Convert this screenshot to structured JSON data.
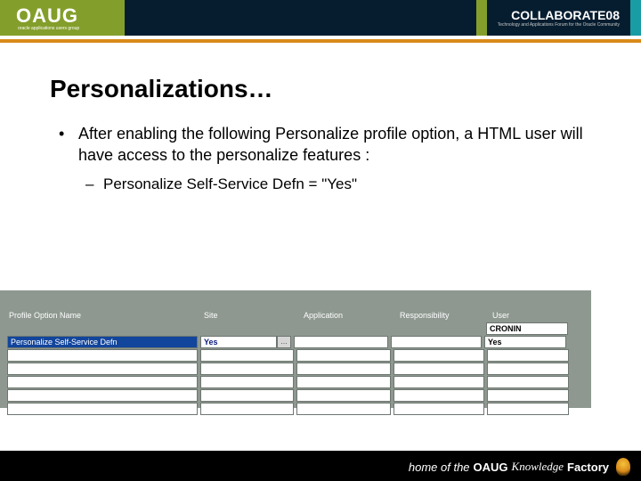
{
  "header": {
    "logo_text": "OAUG",
    "logo_sub": "oracle applications users group",
    "collab_main": "COLLABORATE08",
    "collab_sub": "Technology and Applications Forum for the Oracle Community"
  },
  "slide": {
    "title": "Personalizations…",
    "bullet1": "After enabling the following Personalize profile option, a HTML user will have access to the personalize features :",
    "sub1": "Personalize Self-Service Defn = \"Yes\""
  },
  "form": {
    "headers": {
      "name": "Profile Option Name",
      "site": "Site",
      "app": "Application",
      "resp": "Responsibility",
      "user": "User"
    },
    "user_context": "CRONIN",
    "rows": [
      {
        "name": "Personalize Self-Service Defn",
        "site": "Yes",
        "app": "",
        "resp": "",
        "user": "Yes"
      },
      {
        "name": "",
        "site": "",
        "app": "",
        "resp": "",
        "user": ""
      },
      {
        "name": "",
        "site": "",
        "app": "",
        "resp": "",
        "user": ""
      },
      {
        "name": "",
        "site": "",
        "app": "",
        "resp": "",
        "user": ""
      },
      {
        "name": "",
        "site": "",
        "app": "",
        "resp": "",
        "user": ""
      },
      {
        "name": "",
        "site": "",
        "app": "",
        "resp": "",
        "user": ""
      }
    ],
    "site_button": "…"
  },
  "footer": {
    "prefix": "home of the",
    "brand": "OAUG",
    "suffix": "Knowledge",
    "factory": "Factory"
  }
}
